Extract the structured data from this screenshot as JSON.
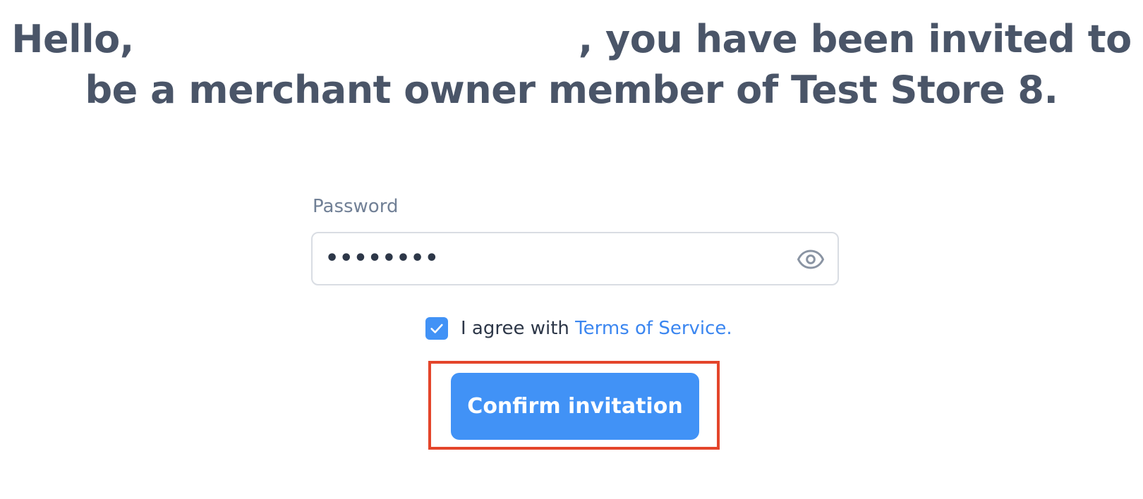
{
  "invite": {
    "greeting": "Hello,",
    "invited_text": ", you have been invited to",
    "role_line": "be a merchant owner member of Test Store 8."
  },
  "form": {
    "password_label": "Password",
    "password_value": "••••••••",
    "agree_text": "I agree with ",
    "tos_link": "Terms of Service.",
    "agree_checked": true,
    "confirm_label": "Confirm invitation"
  },
  "colors": {
    "accent": "#4192f6",
    "link": "#3b86f0",
    "heading": "#4a5568",
    "highlight": "#e4452b"
  },
  "icons": {
    "password_toggle": "eye-icon",
    "checkbox_mark": "check-icon"
  }
}
